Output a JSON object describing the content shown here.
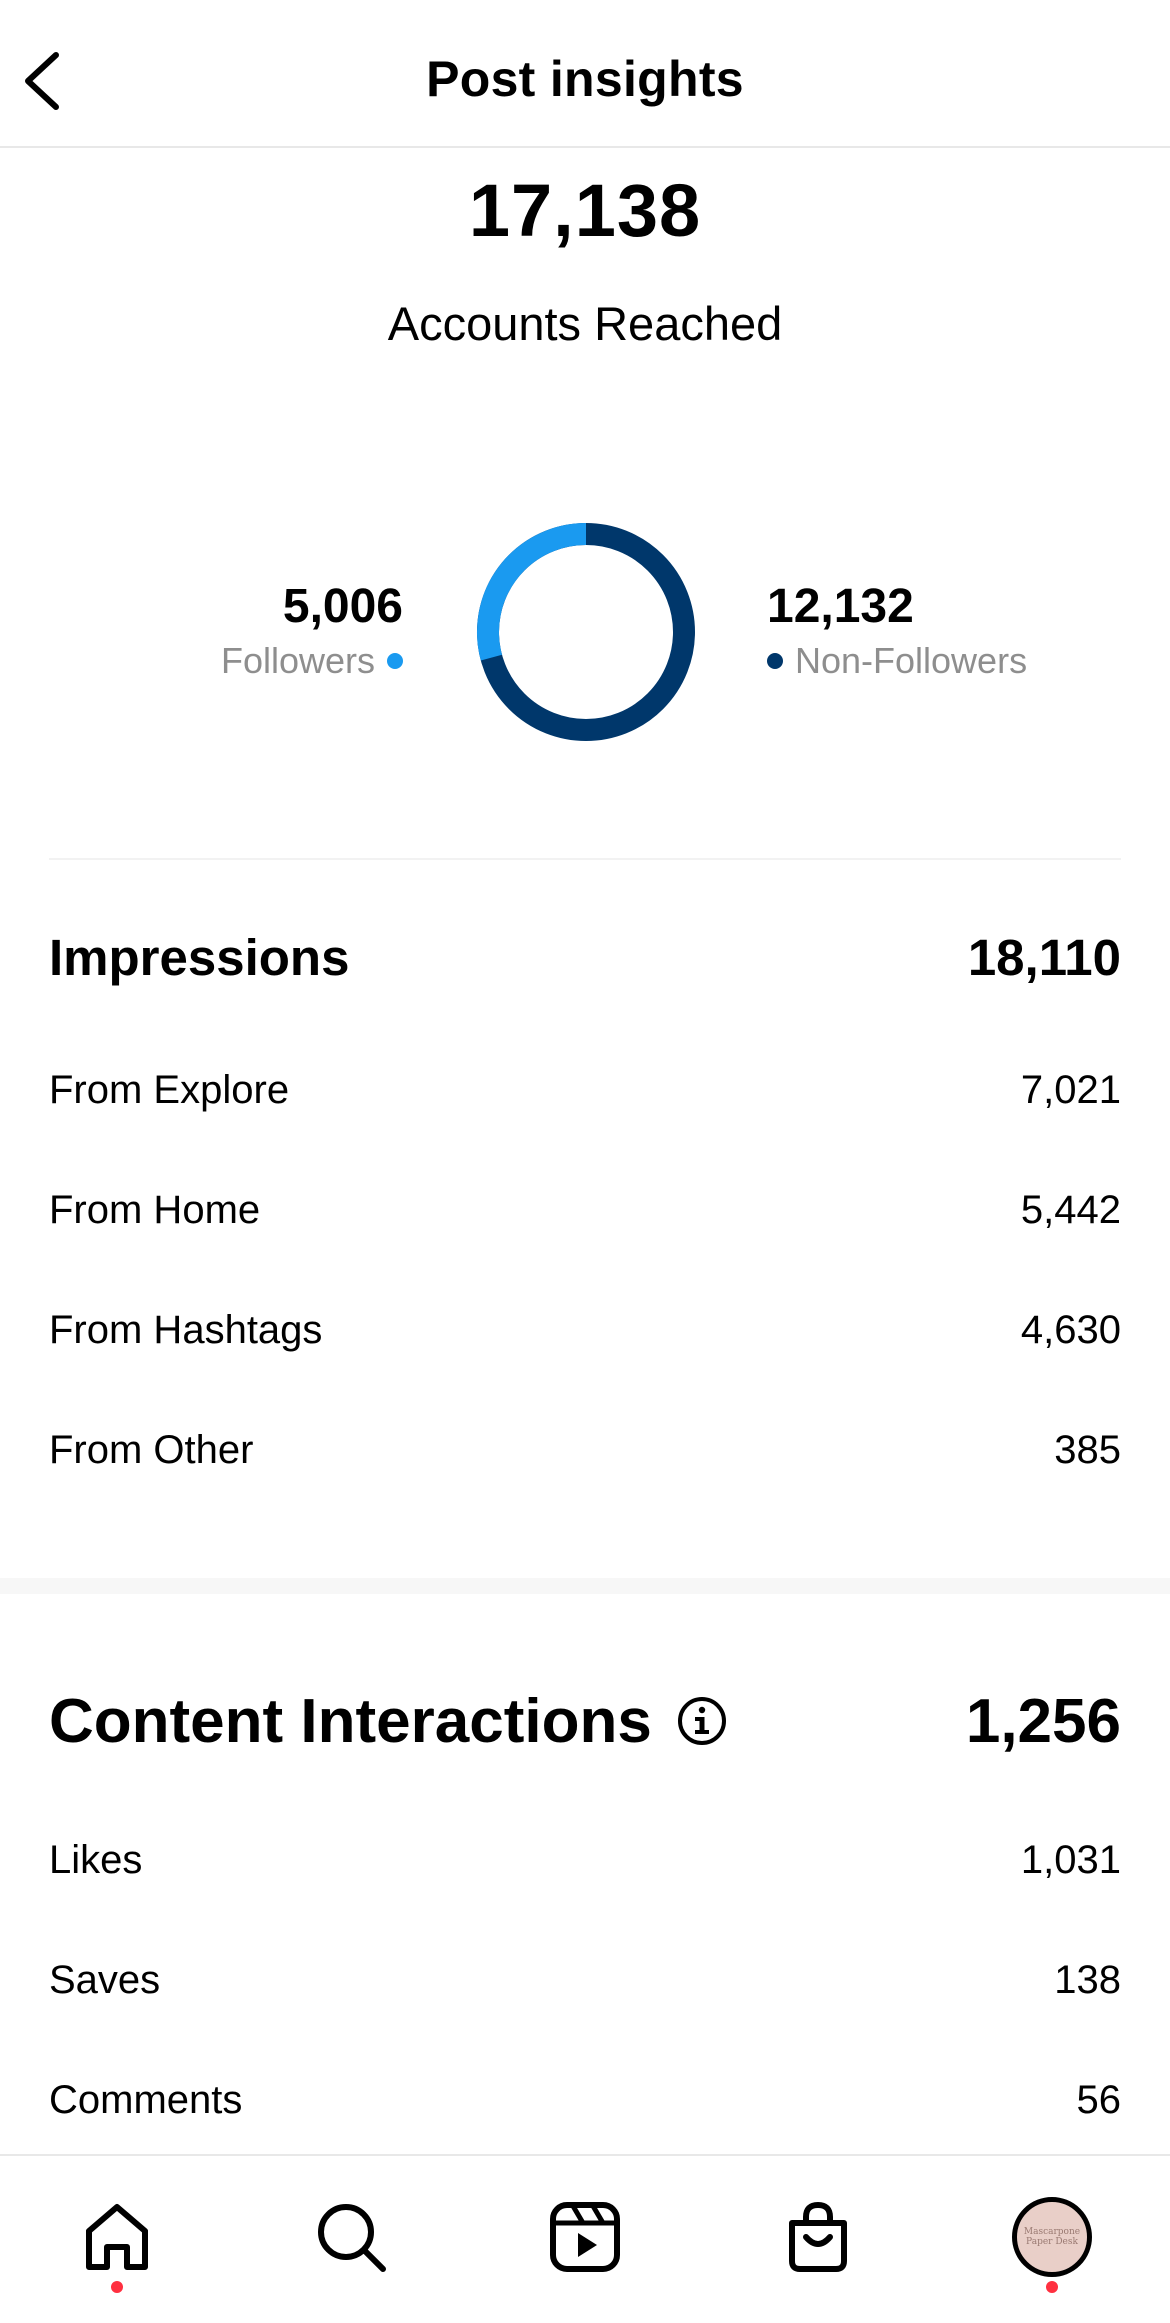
{
  "header": {
    "title": "Post insights"
  },
  "reach": {
    "total": "17,138",
    "label": "Accounts Reached",
    "followers": {
      "value": "5,006",
      "label": "Followers",
      "count": 5006,
      "color": "#1a9af0"
    },
    "non_followers": {
      "value": "12,132",
      "label": "Non-Followers",
      "count": 12132,
      "color": "#00376b"
    }
  },
  "impressions": {
    "title": "Impressions",
    "total": "18,110",
    "rows": [
      {
        "label": "From Explore",
        "value": "7,021"
      },
      {
        "label": "From Home",
        "value": "5,442"
      },
      {
        "label": "From Hashtags",
        "value": "4,630"
      },
      {
        "label": "From Other",
        "value": "385"
      }
    ]
  },
  "interactions": {
    "title": "Content Interactions",
    "total": "1,256",
    "rows": [
      {
        "label": "Likes",
        "value": "1,031"
      },
      {
        "label": "Saves",
        "value": "138"
      },
      {
        "label": "Comments",
        "value": "56"
      }
    ]
  },
  "tabbar": {
    "items": [
      "home-icon",
      "search-icon",
      "reels-icon",
      "shop-icon",
      "profile-avatar"
    ],
    "avatar_text": "Mascarpone Paper Desk",
    "notification_color": "#ff3040"
  }
}
